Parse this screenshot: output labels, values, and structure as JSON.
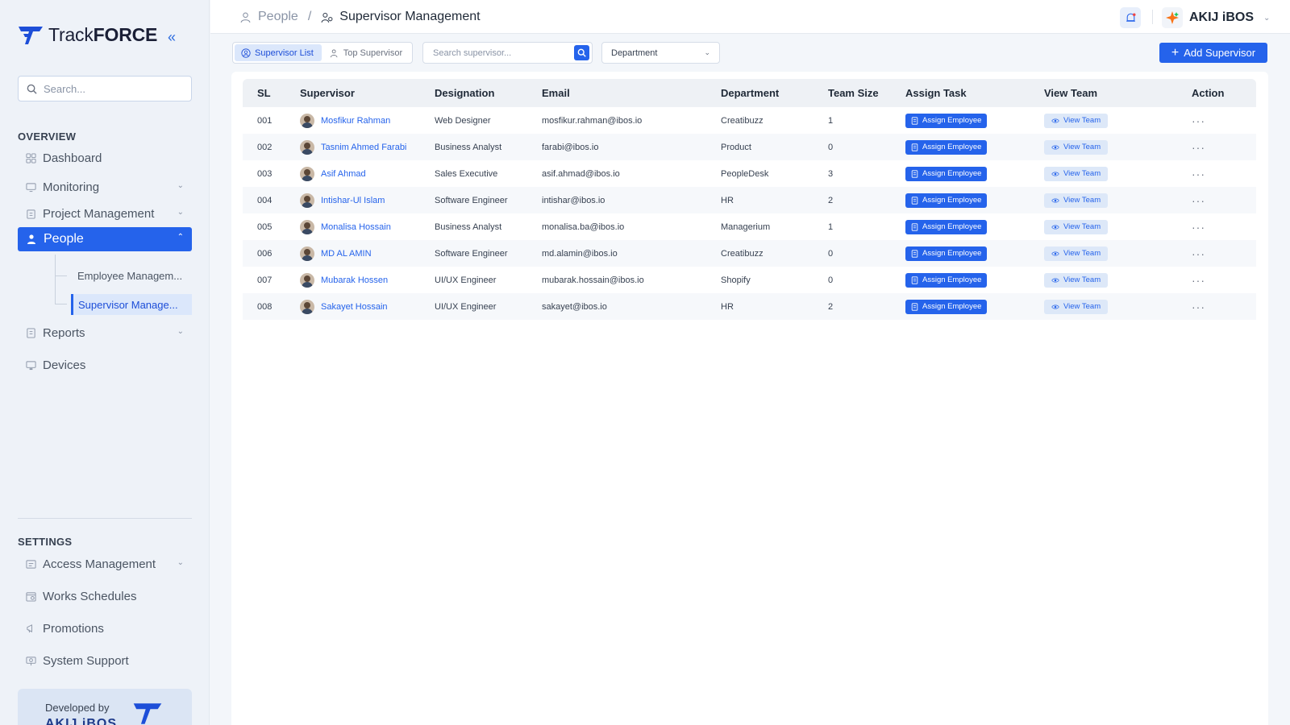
{
  "brand": {
    "name_regular": "Track",
    "name_bold": "FORCE",
    "accent": "#2563eb"
  },
  "sidebar": {
    "search_placeholder": "Search...",
    "overview_title": "OVERVIEW",
    "items": [
      {
        "label": "Dashboard",
        "icon": "grid-icon"
      },
      {
        "label": "Monitoring",
        "icon": "monitor-icon"
      },
      {
        "label": "Project Management",
        "icon": "clipboard-icon"
      },
      {
        "label": "People",
        "icon": "people-icon"
      }
    ],
    "people_sub": [
      {
        "label": "Employee Managem..."
      },
      {
        "label": "Supervisor Manage..."
      }
    ],
    "items2": [
      {
        "label": "Reports",
        "icon": "report-icon"
      },
      {
        "label": "Devices",
        "icon": "device-icon"
      }
    ],
    "settings_title": "SETTINGS",
    "settings_items": [
      {
        "label": "Access Management",
        "icon": "access-icon"
      },
      {
        "label": "Works Schedules",
        "icon": "schedule-icon"
      },
      {
        "label": "Promotions",
        "icon": "megaphone-icon"
      },
      {
        "label": "System Support",
        "icon": "support-icon"
      }
    ],
    "developer": {
      "text": "Developed by",
      "brand": "AKIJ iBOS"
    }
  },
  "header": {
    "breadcrumb": [
      "People",
      "Supervisor Management"
    ],
    "org_name": "AKIJ iBOS"
  },
  "toolbar": {
    "tabs": [
      "Supervisor List",
      "Top Supervisor"
    ],
    "search_placeholder": "Search supervisor...",
    "department_label": "Department",
    "add_label": "Add Supervisor"
  },
  "table": {
    "columns": [
      "SL",
      "Supervisor",
      "Designation",
      "Email",
      "Department",
      "Team Size",
      "Assign Task",
      "View Team",
      "Action"
    ],
    "assign_label": "Assign Employee",
    "view_label": "View Team",
    "action_label": "···",
    "rows": [
      {
        "sl": "001",
        "name": "Mosfikur Rahman",
        "designation": "Web Designer",
        "email": "mosfikur.rahman@ibos.io",
        "department": "Creatibuzz",
        "team_size": "1"
      },
      {
        "sl": "002",
        "name": "Tasnim Ahmed Farabi",
        "designation": "Business Analyst",
        "email": "farabi@ibos.io",
        "department": "Product",
        "team_size": "0"
      },
      {
        "sl": "003",
        "name": "Asif Ahmad",
        "designation": "Sales Executive",
        "email": "asif.ahmad@ibos.io",
        "department": "PeopleDesk",
        "team_size": "3"
      },
      {
        "sl": "004",
        "name": "Intishar-Ul Islam",
        "designation": "Software Engineer",
        "email": "intishar@ibos.io",
        "department": "HR",
        "team_size": "2"
      },
      {
        "sl": "005",
        "name": "Monalisa Hossain",
        "designation": "Business Analyst",
        "email": "monalisa.ba@ibos.io",
        "department": "Managerium",
        "team_size": "1"
      },
      {
        "sl": "006",
        "name": "MD AL AMIN",
        "designation": "Software Engineer",
        "email": "md.alamin@ibos.io",
        "department": "Creatibuzz",
        "team_size": "0"
      },
      {
        "sl": "007",
        "name": "Mubarak Hossen",
        "designation": "UI/UX Engineer",
        "email": "mubarak.hossain@ibos.io",
        "department": "Shopify",
        "team_size": "0"
      },
      {
        "sl": "008",
        "name": "Sakayet Hossain",
        "designation": "UI/UX Engineer",
        "email": "sakayet@ibos.io",
        "department": "HR",
        "team_size": "2"
      }
    ]
  }
}
